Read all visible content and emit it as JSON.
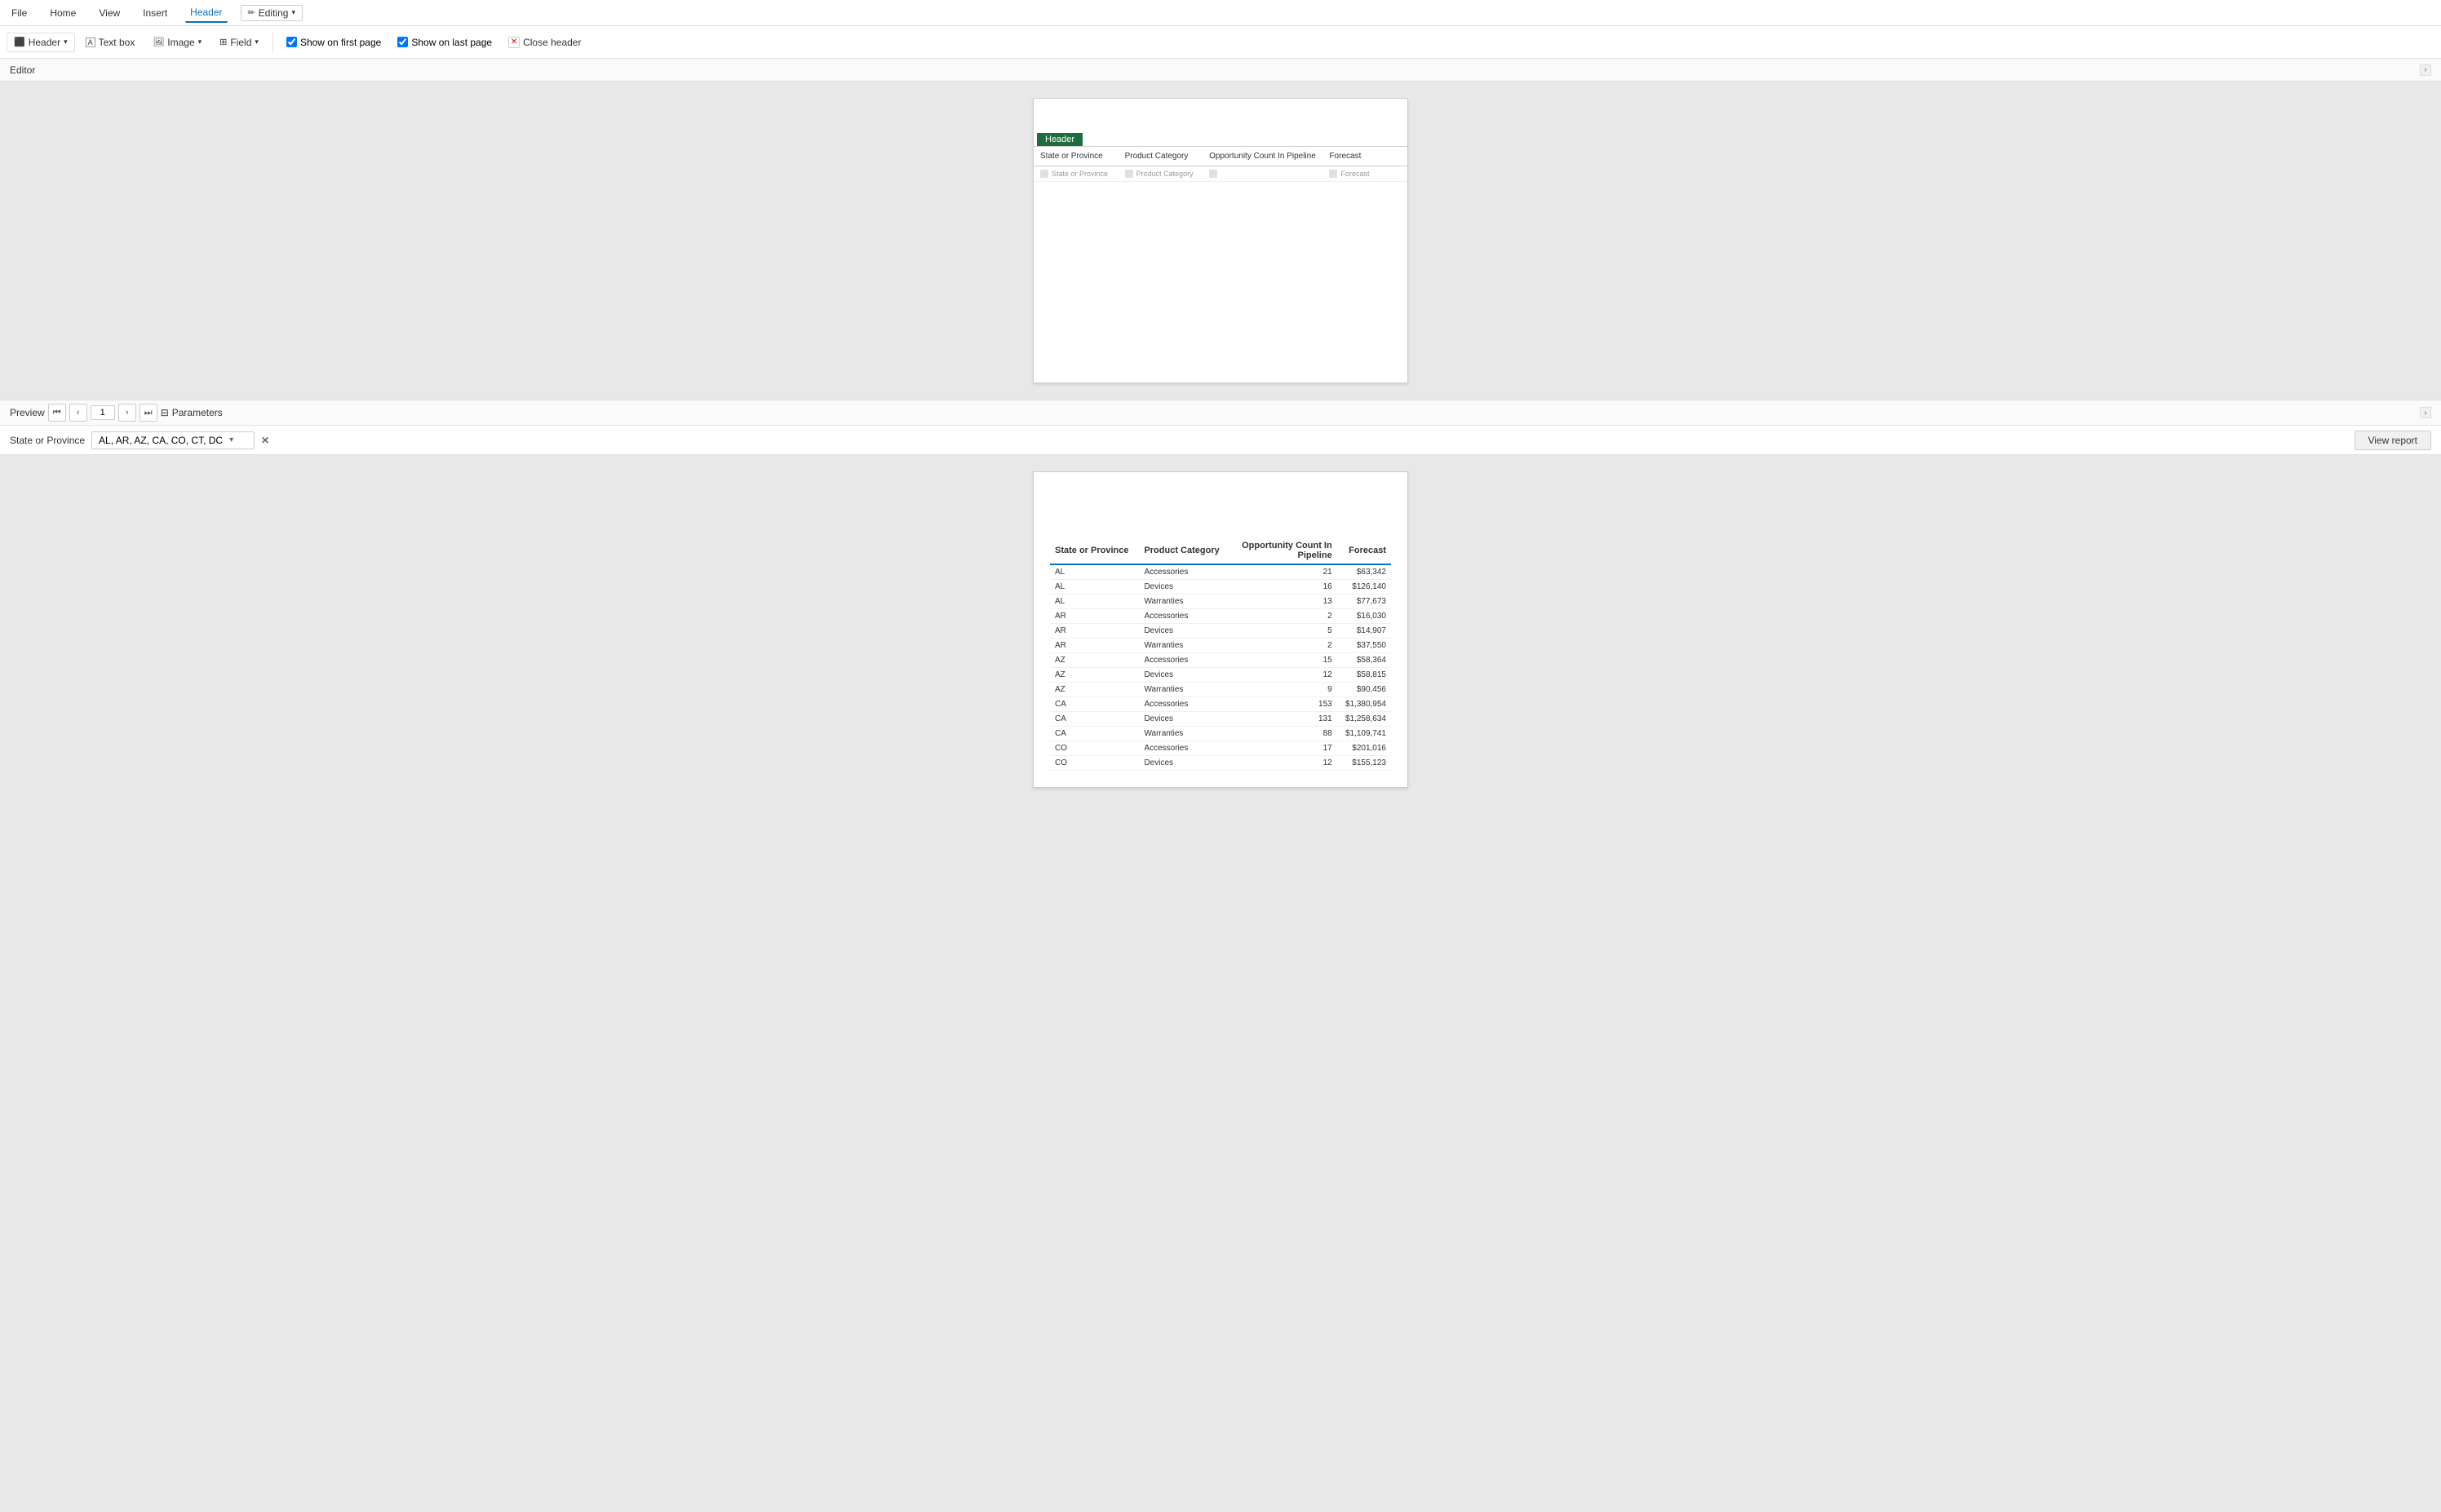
{
  "menuBar": {
    "items": [
      {
        "label": "File",
        "active": false
      },
      {
        "label": "Home",
        "active": false
      },
      {
        "label": "View",
        "active": false
      },
      {
        "label": "Insert",
        "active": false
      },
      {
        "label": "Header",
        "active": true
      },
      {
        "label": "Editing",
        "badge": true
      }
    ]
  },
  "toolbar": {
    "header_label": "Header",
    "textbox_label": "Text box",
    "image_label": "Image",
    "field_label": "Field",
    "show_first_label": "Show on first page",
    "show_last_label": "Show on last page",
    "close_header_label": "Close header"
  },
  "editor": {
    "section_label": "Editor",
    "header_tab": "Header",
    "columns": [
      "State or Province",
      "Product Category",
      "Opportunity Count In Pipeline",
      "Forecast"
    ]
  },
  "preview": {
    "section_label": "Preview",
    "current_page": "1",
    "params_label": "Parameters",
    "state_param_label": "State or Province",
    "state_param_value": "AL, AR, AZ, CA, CO, CT, DC",
    "view_report_label": "View report"
  },
  "previewTable": {
    "columns": [
      "State or Province",
      "Product Category",
      "Opportunity Count In Pipeline",
      "Forecast"
    ],
    "rows": [
      {
        "state": "AL",
        "category": "Accessories",
        "count": "21",
        "forecast": "$63,342"
      },
      {
        "state": "AL",
        "category": "Devices",
        "count": "16",
        "forecast": "$126,140"
      },
      {
        "state": "AL",
        "category": "Warranties",
        "count": "13",
        "forecast": "$77,673"
      },
      {
        "state": "AR",
        "category": "Accessories",
        "count": "2",
        "forecast": "$16,030"
      },
      {
        "state": "AR",
        "category": "Devices",
        "count": "5",
        "forecast": "$14,907"
      },
      {
        "state": "AR",
        "category": "Warranties",
        "count": "2",
        "forecast": "$37,550"
      },
      {
        "state": "AZ",
        "category": "Accessories",
        "count": "15",
        "forecast": "$58,364"
      },
      {
        "state": "AZ",
        "category": "Devices",
        "count": "12",
        "forecast": "$58,815"
      },
      {
        "state": "AZ",
        "category": "Warranties",
        "count": "9",
        "forecast": "$90,456"
      },
      {
        "state": "CA",
        "category": "Accessories",
        "count": "153",
        "forecast": "$1,380,954"
      },
      {
        "state": "CA",
        "category": "Devices",
        "count": "131",
        "forecast": "$1,258,634"
      },
      {
        "state": "CA",
        "category": "Warranties",
        "count": "88",
        "forecast": "$1,109,741"
      },
      {
        "state": "CO",
        "category": "Accessories",
        "count": "17",
        "forecast": "$201,016"
      },
      {
        "state": "CO",
        "category": "Devices",
        "count": "12",
        "forecast": "$155,123"
      }
    ]
  }
}
